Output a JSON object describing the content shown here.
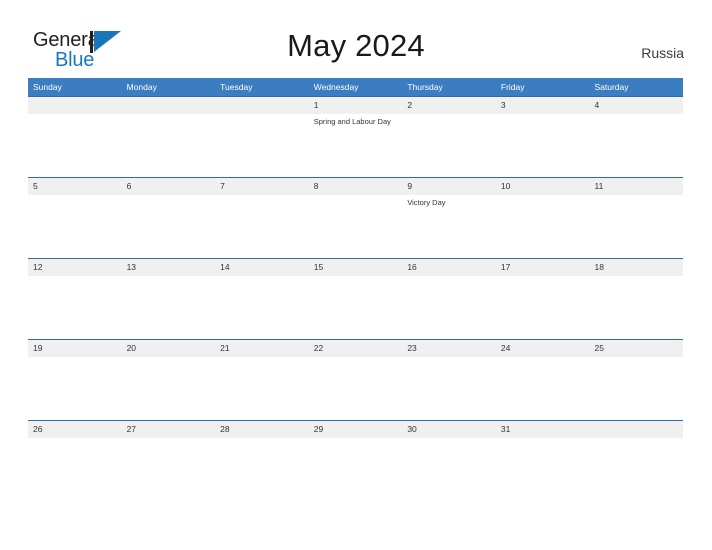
{
  "brand": {
    "name_part1": "General",
    "name_part2": "Blue",
    "accent_color": "#1b75bb",
    "dark_color": "#231f20"
  },
  "header": {
    "title": "May 2024",
    "country": "Russia"
  },
  "colors": {
    "header_blue": "#3c7cc0",
    "row_line_blue": "#2e6da4",
    "band_gray": "#f0f0f0"
  },
  "calendar": {
    "weekday_headers": [
      "Sunday",
      "Monday",
      "Tuesday",
      "Wednesday",
      "Thursday",
      "Friday",
      "Saturday"
    ],
    "weeks": [
      {
        "days": [
          {
            "date": "",
            "event": ""
          },
          {
            "date": "",
            "event": ""
          },
          {
            "date": "",
            "event": ""
          },
          {
            "date": "1",
            "event": "Spring and Labour Day"
          },
          {
            "date": "2",
            "event": ""
          },
          {
            "date": "3",
            "event": ""
          },
          {
            "date": "4",
            "event": ""
          }
        ]
      },
      {
        "days": [
          {
            "date": "5",
            "event": ""
          },
          {
            "date": "6",
            "event": ""
          },
          {
            "date": "7",
            "event": ""
          },
          {
            "date": "8",
            "event": ""
          },
          {
            "date": "9",
            "event": "Victory Day"
          },
          {
            "date": "10",
            "event": ""
          },
          {
            "date": "11",
            "event": ""
          }
        ]
      },
      {
        "days": [
          {
            "date": "12",
            "event": ""
          },
          {
            "date": "13",
            "event": ""
          },
          {
            "date": "14",
            "event": ""
          },
          {
            "date": "15",
            "event": ""
          },
          {
            "date": "16",
            "event": ""
          },
          {
            "date": "17",
            "event": ""
          },
          {
            "date": "18",
            "event": ""
          }
        ]
      },
      {
        "days": [
          {
            "date": "19",
            "event": ""
          },
          {
            "date": "20",
            "event": ""
          },
          {
            "date": "21",
            "event": ""
          },
          {
            "date": "22",
            "event": ""
          },
          {
            "date": "23",
            "event": ""
          },
          {
            "date": "24",
            "event": ""
          },
          {
            "date": "25",
            "event": ""
          }
        ]
      },
      {
        "days": [
          {
            "date": "26",
            "event": ""
          },
          {
            "date": "27",
            "event": ""
          },
          {
            "date": "28",
            "event": ""
          },
          {
            "date": "29",
            "event": ""
          },
          {
            "date": "30",
            "event": ""
          },
          {
            "date": "31",
            "event": ""
          },
          {
            "date": "",
            "event": ""
          }
        ]
      }
    ]
  }
}
